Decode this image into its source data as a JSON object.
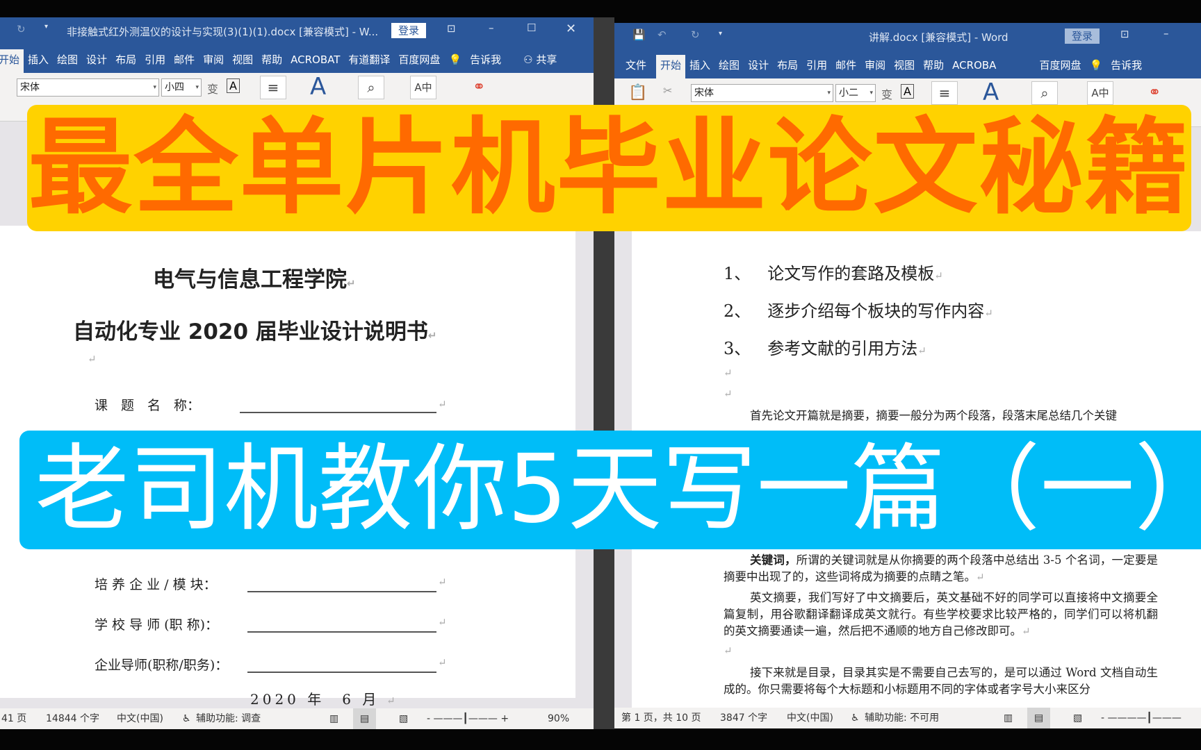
{
  "left_window": {
    "title": "非接触式红外测温仪的设计与实现(3)(1)(1).docx [兼容模式] - W...",
    "login": "登录",
    "tabs": [
      "开始",
      "插入",
      "绘图",
      "设计",
      "布局",
      "引用",
      "邮件",
      "审阅",
      "视图",
      "帮助",
      "ACROBAT",
      "有道翻译",
      "百度网盘"
    ],
    "tell_me": "告诉我",
    "share": "共享",
    "font": "宋体",
    "size": "小四",
    "document": {
      "school": "电气与信息工程学院",
      "subtitle": "自动化专业 2020 届毕业设计说明书",
      "fields": [
        "课　题　名　称：",
        "培 养 企 业 / 模 块：",
        "学 校 导 师 (职 称)：",
        "企业导师(职称/职务)："
      ],
      "date": "2020 年　6 月"
    },
    "status": {
      "page": "41 页",
      "words": "14844 个字",
      "lang": "中文(中国)",
      "accessibility": "辅助功能: 调查",
      "zoom": "90%"
    }
  },
  "right_window": {
    "title": "讲解.docx [兼容模式] - Word",
    "login": "登录",
    "tabs": [
      "文件",
      "开始",
      "插入",
      "绘图",
      "设计",
      "布局",
      "引用",
      "邮件",
      "审阅",
      "视图",
      "帮助",
      "ACROBA",
      "百度网盘"
    ],
    "active_tab": "开始",
    "tell_me": "告诉我",
    "font": "宋体",
    "size": "小二",
    "document": {
      "list": [
        {
          "num": "1、",
          "text": "论文写作的套路及模板"
        },
        {
          "num": "2、",
          "text": "逐步介绍每个板块的写作内容"
        },
        {
          "num": "3、",
          "text": "参考文献的引用方法"
        }
      ],
      "p1": "首先论文开篇就是摘要，摘要一般分为两个段落，段落末尾总结几个关键",
      "kw_bold": "关键词，",
      "kw_rest": "所谓的关键词就是从你摘要的两个段落中总结出 3-5 个名词，一定要是摘要中出现了的，这些词将成为摘要的点睛之笔。",
      "p_en": "英文摘要，我们写好了中文摘要后，英文基础不好的同学可以直接将中文摘要全篇复制，用谷歌翻译翻译成英文就行。有些学校要求比较严格的，同学们可以将机翻的英文摘要通读一遍，然后把不通顺的地方自己修改即可。",
      "p_toc": "接下来就是目录，目录其实是不需要自己去写的，是可以通过 Word 文档自动生成的。你只需要将每个大标题和小标题用不同的字体或者字号大小来区分"
    },
    "status": {
      "page": "第 1 页，共 10 页",
      "words": "3847 个字",
      "lang": "中文(中国)",
      "accessibility": "辅助功能: 不可用"
    }
  },
  "banners": {
    "top": "最全单片机毕业论文秘籍",
    "bottom": "老司机教你5天写一篇（一）",
    "colors": {
      "top_bg": "#ffd200",
      "top_text": "#ff6a00",
      "bottom_bg": "#00bdf8",
      "bottom_text": "#ffffff"
    }
  }
}
